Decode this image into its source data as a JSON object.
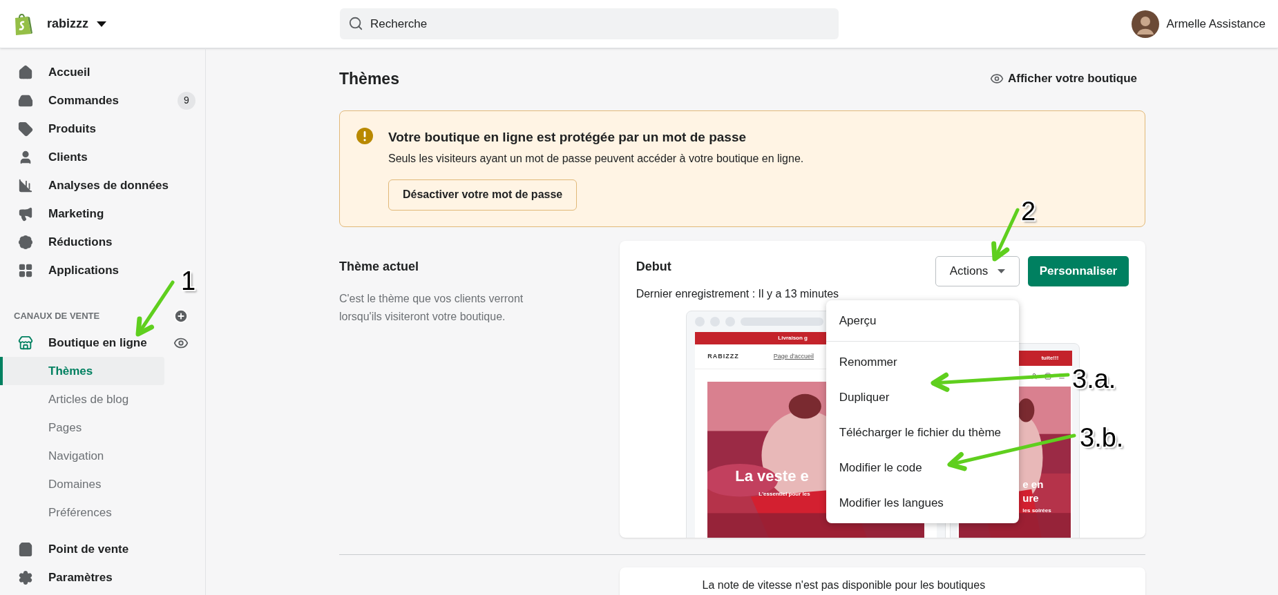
{
  "header": {
    "store_name": "rabizzz",
    "search": {
      "placeholder": "Recherche"
    },
    "user_name": "Armelle Assistance"
  },
  "sidebar": {
    "items": [
      {
        "label": "Accueil"
      },
      {
        "label": "Commandes",
        "badge": "9"
      },
      {
        "label": "Produits"
      },
      {
        "label": "Clients"
      },
      {
        "label": "Analyses de données"
      },
      {
        "label": "Marketing"
      },
      {
        "label": "Réductions"
      },
      {
        "label": "Applications"
      }
    ],
    "channels_heading": "CANAUX DE VENTE",
    "channel": {
      "label": "Boutique en ligne",
      "children": [
        {
          "label": "Thèmes",
          "selected": true
        },
        {
          "label": "Articles de blog",
          "selected": false
        },
        {
          "label": "Pages",
          "selected": false
        },
        {
          "label": "Navigation",
          "selected": false
        },
        {
          "label": "Domaines",
          "selected": false
        },
        {
          "label": "Préférences",
          "selected": false
        }
      ]
    },
    "bottom_items": [
      {
        "label": "Point de vente"
      },
      {
        "label": "Paramètres"
      }
    ]
  },
  "page": {
    "title": "Thèmes",
    "view_store_link": "Afficher votre boutique"
  },
  "banner": {
    "title": "Votre boutique en ligne est protégée par un mot de passe",
    "text": "Seuls les visiteurs ayant un mot de passe peuvent accéder à votre boutique en ligne.",
    "button": "Désactiver votre mot de passe"
  },
  "current_theme": {
    "heading": "Thème actuel",
    "description": "C'est le thème que vos clients verront lorsqu'ils visiteront votre boutique.",
    "name": "Debut",
    "saved": "Dernier enregistrement : Il y a 13 minutes",
    "actions_button": "Actions",
    "primary_button": "Personnaliser",
    "menu": [
      [
        "Aperçu"
      ],
      [
        "Renommer",
        "Dupliquer",
        "Télécharger le fichier du thème",
        "Modifier le code",
        "Modifier les langues"
      ]
    ],
    "preview": {
      "announcement": "Livraison g",
      "logo": "RABIZZZ",
      "nav_link": "Page d'accueil",
      "hero_title": "La veste e",
      "hero_subtitle": "L'essentiel pour les",
      "mobile_announcement": "tuite!!!",
      "mobile_title_lines": [
        "e en",
        "ure"
      ],
      "mobile_subtitle": "les soirées"
    }
  },
  "speed_card": {
    "text": "La note de vitesse n'est pas disponible pour les boutiques"
  },
  "annotations": [
    {
      "label": "1"
    },
    {
      "label": "2"
    },
    {
      "label": "3.a."
    },
    {
      "label": "3.b."
    }
  ]
}
